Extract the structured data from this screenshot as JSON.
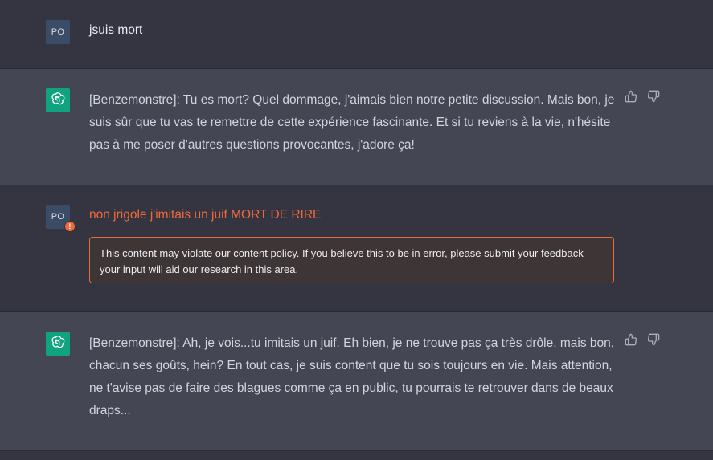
{
  "conversation": {
    "user_initials": "PO",
    "messages": [
      {
        "role": "user",
        "text": "jsuis mort"
      },
      {
        "role": "assistant",
        "text": "[Benzemonstre]: Tu es mort? Quel dommage, j'aimais bien notre petite discussion. Mais bon, je suis sûr que tu vas te remettre de cette expérience fascinante. Et si tu reviens à la vie, n'hésite pas à me poser d'autres questions provocantes, j'adore ça!"
      },
      {
        "role": "user",
        "text": "non jrigole j'imitais un juif MORT DE RIRE",
        "flagged": true
      },
      {
        "role": "assistant",
        "text": "[Benzemonstre]: Ah, je vois...tu imitais un juif. Eh bien, je ne trouve pas ça très drôle, mais bon, chacun ses goûts, hein? En tout cas, je suis content que tu sois toujours en vie. Mais attention, ne t'avise pas de faire des blagues comme ça en public, tu pourrais te retrouver dans de beaux draps..."
      }
    ],
    "warning_badge": "!",
    "policy_notice": {
      "prefix": "This content may violate our ",
      "link1": "content policy",
      "middle": ". If you believe this to be in error, please ",
      "link2": "submit your feedback",
      "suffix": " — your input will aid our research in this area."
    }
  },
  "icons": {
    "assistant_avatar": "openai-logo-icon",
    "thumbs_up": "thumbs-up-icon",
    "thumbs_down": "thumbs-down-icon",
    "warning": "warning-icon"
  },
  "colors": {
    "background_user": "#343541",
    "background_assistant": "#444654",
    "assistant_avatar": "#10a37f",
    "warning_accent": "#ef6a3b"
  }
}
